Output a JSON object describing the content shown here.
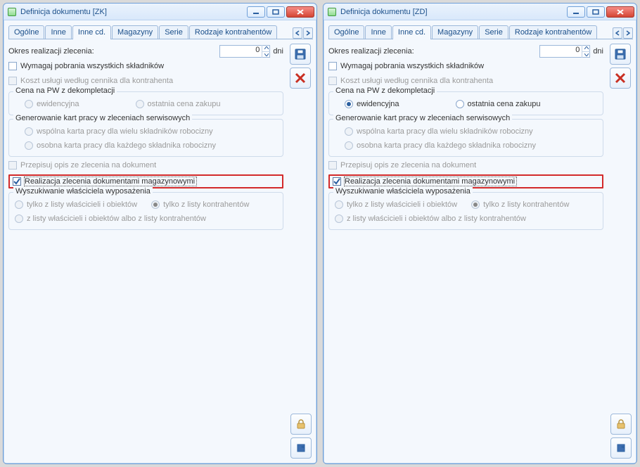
{
  "tabs": {
    "ogolne": "Ogólne",
    "inne": "Inne",
    "inne_cd": "Inne cd.",
    "magazyny": "Magazyny",
    "serie": "Serie",
    "rodzaje": "Rodzaje kontrahentów"
  },
  "left": {
    "title": "Definicja dokumentu [ZK]",
    "okres_label": "Okres realizacji zlecenia:",
    "okres_value": "0",
    "okres_unit": "dni",
    "chk_wymagaj": "Wymagaj pobrania wszystkich składników",
    "chk_koszt": "Koszt usługi według cennika dla kontrahenta",
    "grp_cena": "Cena na PW z dekompletacji",
    "rad_ewid": "ewidencyjna",
    "rad_ost": "ostatnia cena zakupu",
    "grp_gen": "Generowanie kart pracy w zleceniach serwisowych",
    "rad_wsp": "wspólna karta pracy dla wielu składników robocizny",
    "rad_oso": "osobna karta pracy dla każdego składnika robocizny",
    "chk_przepisuj": "Przepisuj opis ze zlecenia na dokument",
    "chk_realiz": "Realizacja zlecenia dokumentami magazynowymi",
    "grp_wysz": "Wyszukiwanie właściciela wyposażenia",
    "rad_wl": "tylko z listy właścicieli i obiektów",
    "rad_ko": "tylko z listy kontrahentów",
    "rad_both": "z listy właścicieli i obiektów albo z listy kontrahentów"
  },
  "right": {
    "title": "Definicja dokumentu [ZD]",
    "okres_label": "Okres realizacji zlecenia:",
    "okres_value": "0",
    "okres_unit": "dni",
    "chk_wymagaj": "Wymagaj pobrania wszystkich składników",
    "chk_koszt": "Koszt usługi według cennika dla kontrahenta",
    "grp_cena": "Cena na PW z dekompletacji",
    "rad_ewid": "ewidencyjna",
    "rad_ost": "ostatnia cena zakupu",
    "grp_gen": "Generowanie kart pracy w zleceniach serwisowych",
    "rad_wsp": "wspólna karta pracy dla wielu składników robocizny",
    "rad_oso": "osobna karta pracy dla każdego składnika robocizny",
    "chk_przepisuj": "Przepisuj opis ze zlecenia na dokument",
    "chk_realiz": "Realizacja zlecenia dokumentami magazynowymi",
    "grp_wysz": "Wyszukiwanie właściciela wyposażenia",
    "rad_wl": "tylko z listy właścicieli i obiektów",
    "rad_ko": "tylko z listy kontrahentów",
    "rad_both": "z listy właścicieli i obiektów albo z listy kontrahentów"
  }
}
